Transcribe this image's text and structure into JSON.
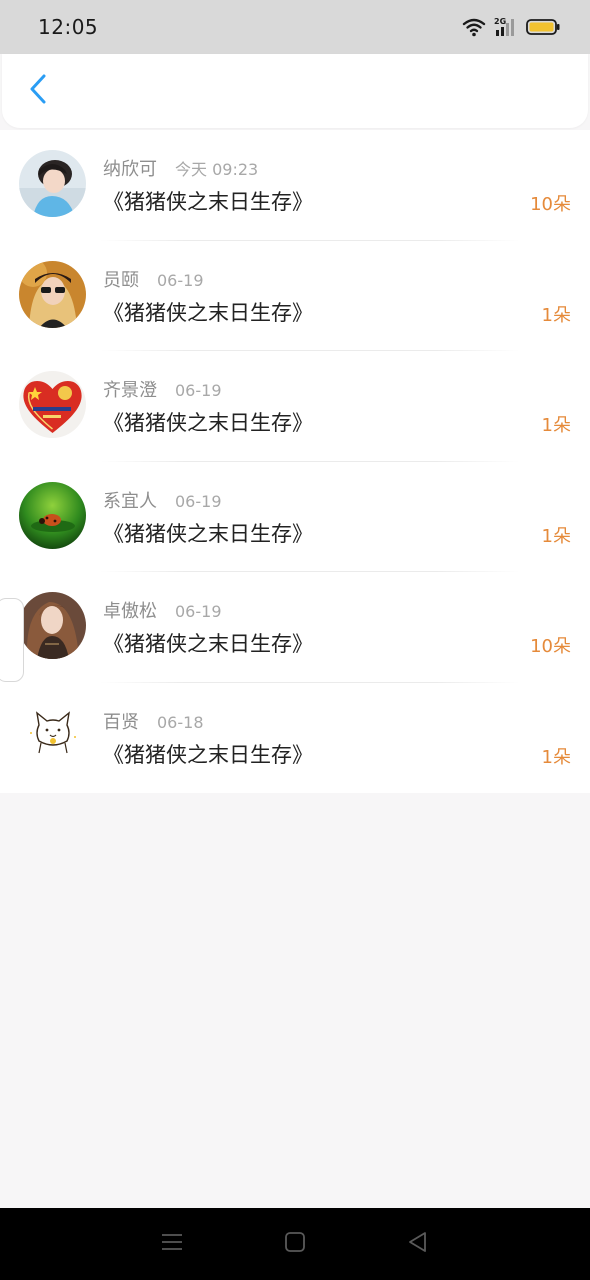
{
  "status_bar": {
    "time": "12:05",
    "network_label": "2G",
    "icons": [
      "wifi-icon",
      "signal-icon",
      "battery-icon"
    ]
  },
  "header": {
    "back_icon": "chevron-left-icon",
    "accent_color": "#2a9df4"
  },
  "list": {
    "items": [
      {
        "name": "纳欣可",
        "time": "今天 09:23",
        "title": "《猪猪侠之末日生存》",
        "count": "10朵",
        "avatar": "avatar-boy-photo"
      },
      {
        "name": "员颐",
        "time": "06-19",
        "title": "《猪猪侠之末日生存》",
        "count": "1朵",
        "avatar": "avatar-woman-sunglasses"
      },
      {
        "name": "齐景澄",
        "time": "06-19",
        "title": "《猪猪侠之末日生存》",
        "count": "1朵",
        "avatar": "avatar-heart-flag"
      },
      {
        "name": "系宜人",
        "time": "06-19",
        "title": "《猪猪侠之末日生存》",
        "count": "1朵",
        "avatar": "avatar-green-ladybug"
      },
      {
        "name": "卓傲松",
        "time": "06-19",
        "title": "《猪猪侠之末日生存》",
        "count": "10朵",
        "avatar": "avatar-woman-portrait"
      },
      {
        "name": "百贤",
        "time": "06-18",
        "title": "《猪猪侠之末日生存》",
        "count": "1朵",
        "avatar": "avatar-cartoon-cat"
      }
    ]
  },
  "colors": {
    "count_color": "#e58a3a",
    "name_color": "#8e8e8e",
    "title_color": "#222222"
  },
  "nav_bar": {
    "buttons": [
      "menu-icon",
      "home-icon",
      "back-triangle-icon"
    ]
  }
}
